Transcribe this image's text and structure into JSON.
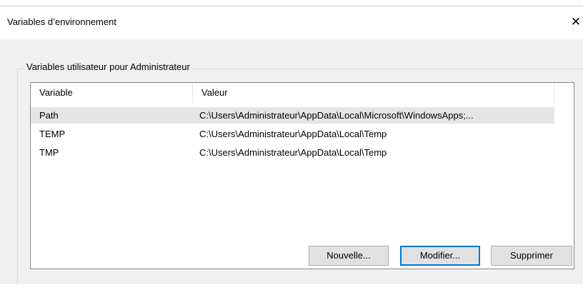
{
  "window": {
    "title": "Variables d’environnement",
    "close_glyph": "✕"
  },
  "user_group": {
    "legend": "Variables utilisateur pour Administrateur",
    "columns": [
      "Variable",
      "Valeur"
    ],
    "rows": [
      {
        "name": "Path",
        "value": "C:\\Users\\Administrateur\\AppData\\Local\\Microsoft\\WindowsApps;...",
        "selected": true
      },
      {
        "name": "TEMP",
        "value": "C:\\Users\\Administrateur\\AppData\\Local\\Temp",
        "selected": false
      },
      {
        "name": "TMP",
        "value": "C:\\Users\\Administrateur\\AppData\\Local\\Temp",
        "selected": false
      }
    ],
    "buttons": {
      "new_label": "Nouvelle...",
      "edit_label": "Modifier...",
      "delete_label": "Supprimer"
    }
  },
  "colors": {
    "dialog_bg": "#f0f0f0",
    "selection_bg": "#e5e5e5",
    "focus_border": "#0078d7"
  }
}
